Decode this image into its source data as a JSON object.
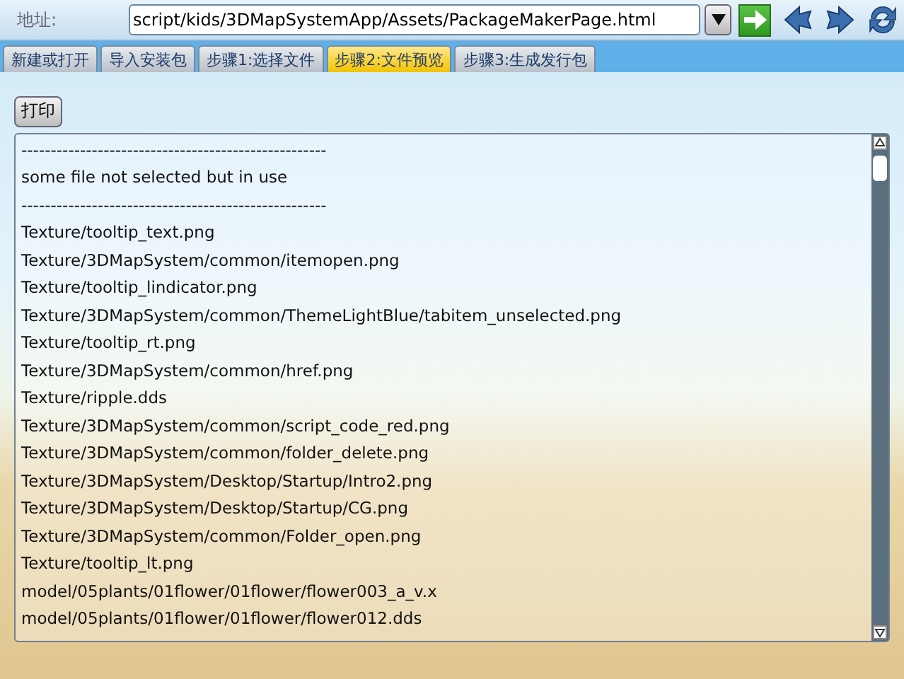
{
  "address_bar": {
    "label": "地址:",
    "value": "script/kids/3DMapSystemApp/Assets/PackageMakerPage.html"
  },
  "tabs": [
    {
      "label": "新建或打开",
      "selected": false
    },
    {
      "label": "导入安装包",
      "selected": false
    },
    {
      "label": "步骤1:选择文件",
      "selected": false
    },
    {
      "label": "步骤2:文件预览",
      "selected": true
    },
    {
      "label": "步骤3:生成发行包",
      "selected": false
    }
  ],
  "print_button": "打印",
  "file_list": [
    "----------------------------------------------------",
    "some file not selected but in use",
    "----------------------------------------------------",
    "Texture/tooltip_text.png",
    "Texture/3DMapSystem/common/itemopen.png",
    "Texture/tooltip_lindicator.png",
    "Texture/3DMapSystem/common/ThemeLightBlue/tabitem_unselected.png",
    "Texture/tooltip_rt.png",
    "Texture/3DMapSystem/common/href.png",
    "Texture/ripple.dds",
    "Texture/3DMapSystem/common/script_code_red.png",
    "Texture/3DMapSystem/common/folder_delete.png",
    "Texture/3DMapSystem/Desktop/Startup/Intro2.png",
    "Texture/3DMapSystem/Desktop/Startup/CG.png",
    "Texture/3DMapSystem/common/Folder_open.png",
    "Texture/tooltip_lt.png",
    "model/05plants/01flower/01flower/flower003_a_v.x",
    "model/05plants/01flower/01flower/flower012.dds"
  ]
}
